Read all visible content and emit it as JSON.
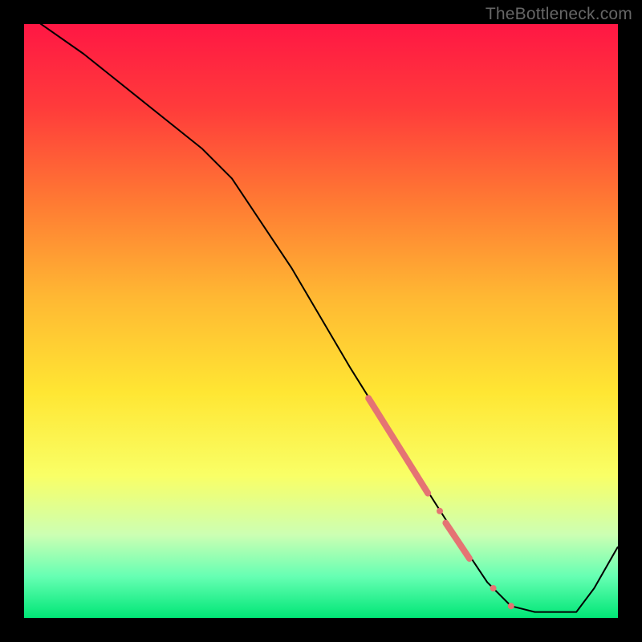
{
  "watermark": "TheBottleneck.com",
  "chart_data": {
    "type": "line",
    "title": "",
    "xlabel": "",
    "ylabel": "",
    "xlim": [
      0,
      100
    ],
    "ylim": [
      0,
      100
    ],
    "grid": false,
    "legend": false,
    "gradient_stops": [
      {
        "offset": 0,
        "color": "#ff1744"
      },
      {
        "offset": 0.14,
        "color": "#ff3b3b"
      },
      {
        "offset": 0.3,
        "color": "#ff7a33"
      },
      {
        "offset": 0.46,
        "color": "#ffb833"
      },
      {
        "offset": 0.62,
        "color": "#ffe633"
      },
      {
        "offset": 0.76,
        "color": "#f9ff66"
      },
      {
        "offset": 0.86,
        "color": "#ccffb3"
      },
      {
        "offset": 0.93,
        "color": "#66ffb3"
      },
      {
        "offset": 1.0,
        "color": "#00e676"
      }
    ],
    "series": [
      {
        "name": "curve",
        "color": "#000000",
        "stroke_width": 2,
        "x": [
          0,
          10,
          20,
          30,
          35,
          45,
          55,
          65,
          72,
          78,
          82,
          86,
          93,
          96,
          100
        ],
        "y": [
          102,
          95,
          87,
          79,
          74,
          59,
          42,
          26,
          15,
          6,
          2,
          1,
          1,
          5,
          12
        ]
      }
    ],
    "markers": [
      {
        "name": "segment-a",
        "type": "thick-line",
        "color": "#e57373",
        "stroke_width": 8,
        "points": [
          {
            "x": 58,
            "y": 37
          },
          {
            "x": 68,
            "y": 21
          }
        ]
      },
      {
        "name": "dot-a",
        "type": "dot",
        "color": "#e57373",
        "r": 4,
        "x": 70,
        "y": 18
      },
      {
        "name": "segment-b",
        "type": "thick-line",
        "color": "#e57373",
        "stroke_width": 8,
        "points": [
          {
            "x": 71,
            "y": 16
          },
          {
            "x": 75,
            "y": 10
          }
        ]
      },
      {
        "name": "dot-b",
        "type": "dot",
        "color": "#e57373",
        "r": 4,
        "x": 79,
        "y": 5
      },
      {
        "name": "dot-c",
        "type": "dot",
        "color": "#e57373",
        "r": 4,
        "x": 82,
        "y": 2
      }
    ]
  }
}
